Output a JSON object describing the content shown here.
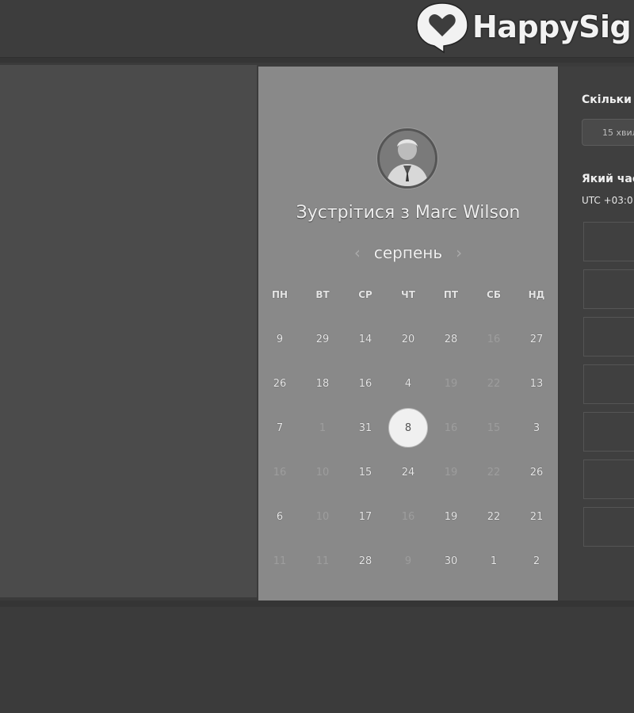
{
  "header": {
    "brand_name": "HappySig",
    "logo_icon": "heart-speech-bubble-icon"
  },
  "meeting": {
    "title": "Зустрітися з Marc Wilson",
    "avatar": "avatar-photo",
    "month": "серпень",
    "prev_icon": "chevron-left-icon",
    "next_icon": "chevron-right-icon",
    "weekdays": [
      "ПН",
      "ВТ",
      "СР",
      "ЧТ",
      "ПТ",
      "СБ",
      "НД"
    ],
    "weeks": [
      [
        "9",
        "29",
        "14",
        "20",
        "28",
        "16",
        "27"
      ],
      [
        "26",
        "18",
        "16",
        "4",
        "19",
        "22",
        "13"
      ],
      [
        "7",
        "1",
        "31",
        "8",
        "16",
        "15",
        "3"
      ],
      [
        "16",
        "10",
        "15",
        "24",
        "19",
        "22",
        "26"
      ],
      [
        "6",
        "10",
        "17",
        "16",
        "19",
        "22",
        "21"
      ],
      [
        "11",
        "11",
        "28",
        "9",
        "30",
        "1",
        "2"
      ]
    ],
    "selected_day": "8"
  },
  "booking": {
    "duration_label": "Скільки ч",
    "duration_value": "15 хвил",
    "time_label": "Який час",
    "timezone": "UTC +03:0"
  },
  "colors": {
    "page_bg": "#3b3b3b",
    "card_bg": "#898989",
    "selected_bg": "#f0f0f0"
  }
}
